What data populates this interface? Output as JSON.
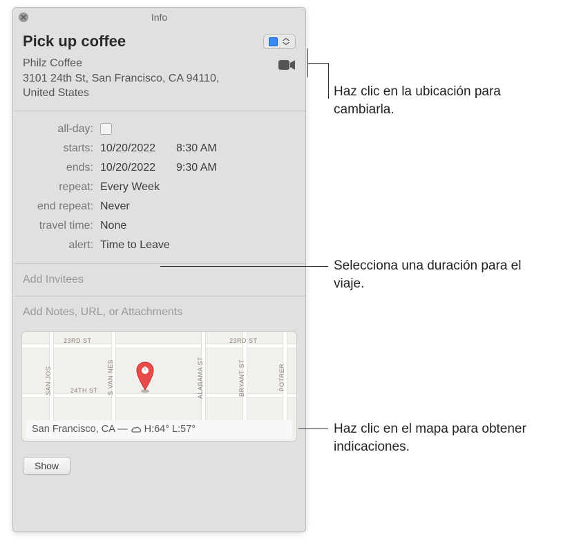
{
  "window": {
    "title": "Info"
  },
  "event": {
    "title": "Pick up coffee",
    "location_name": "Philz Coffee",
    "location_address": "3101 24th St, San Francisco, CA 94110, United States"
  },
  "details": {
    "allday_label": "all-day:",
    "starts_label": "starts:",
    "starts_date": "10/20/2022",
    "starts_time": "8:30 AM",
    "ends_label": "ends:",
    "ends_date": "10/20/2022",
    "ends_time": "9:30 AM",
    "repeat_label": "repeat:",
    "repeat_value": "Every Week",
    "end_repeat_label": "end repeat:",
    "end_repeat_value": "Never",
    "travel_time_label": "travel time:",
    "travel_time_value": "None",
    "alert_label": "alert:",
    "alert_value": "Time to Leave"
  },
  "sections": {
    "invitees_placeholder": "Add Invitees",
    "notes_placeholder": "Add Notes, URL, or Attachments"
  },
  "map": {
    "streets": {
      "23rd_a": "23RD ST",
      "23rd_b": "23RD ST",
      "24th": "24TH ST",
      "san_jose": "SAN JOS",
      "s_van_nes": "S VAN NES",
      "alabama": "ALABAMA ST",
      "bryant": "BRYANT ST",
      "potrer": "POTRER"
    },
    "weather_city": "San Francisco, CA — ",
    "weather_hi": " H:64° ",
    "weather_lo": "L:57°"
  },
  "footer": {
    "show_label": "Show"
  },
  "callouts": {
    "location": "Haz clic en la ubicación para cambiarla.",
    "travel": "Selecciona una duración para el viaje.",
    "map": "Haz clic en el mapa para obtener indicaciones."
  }
}
